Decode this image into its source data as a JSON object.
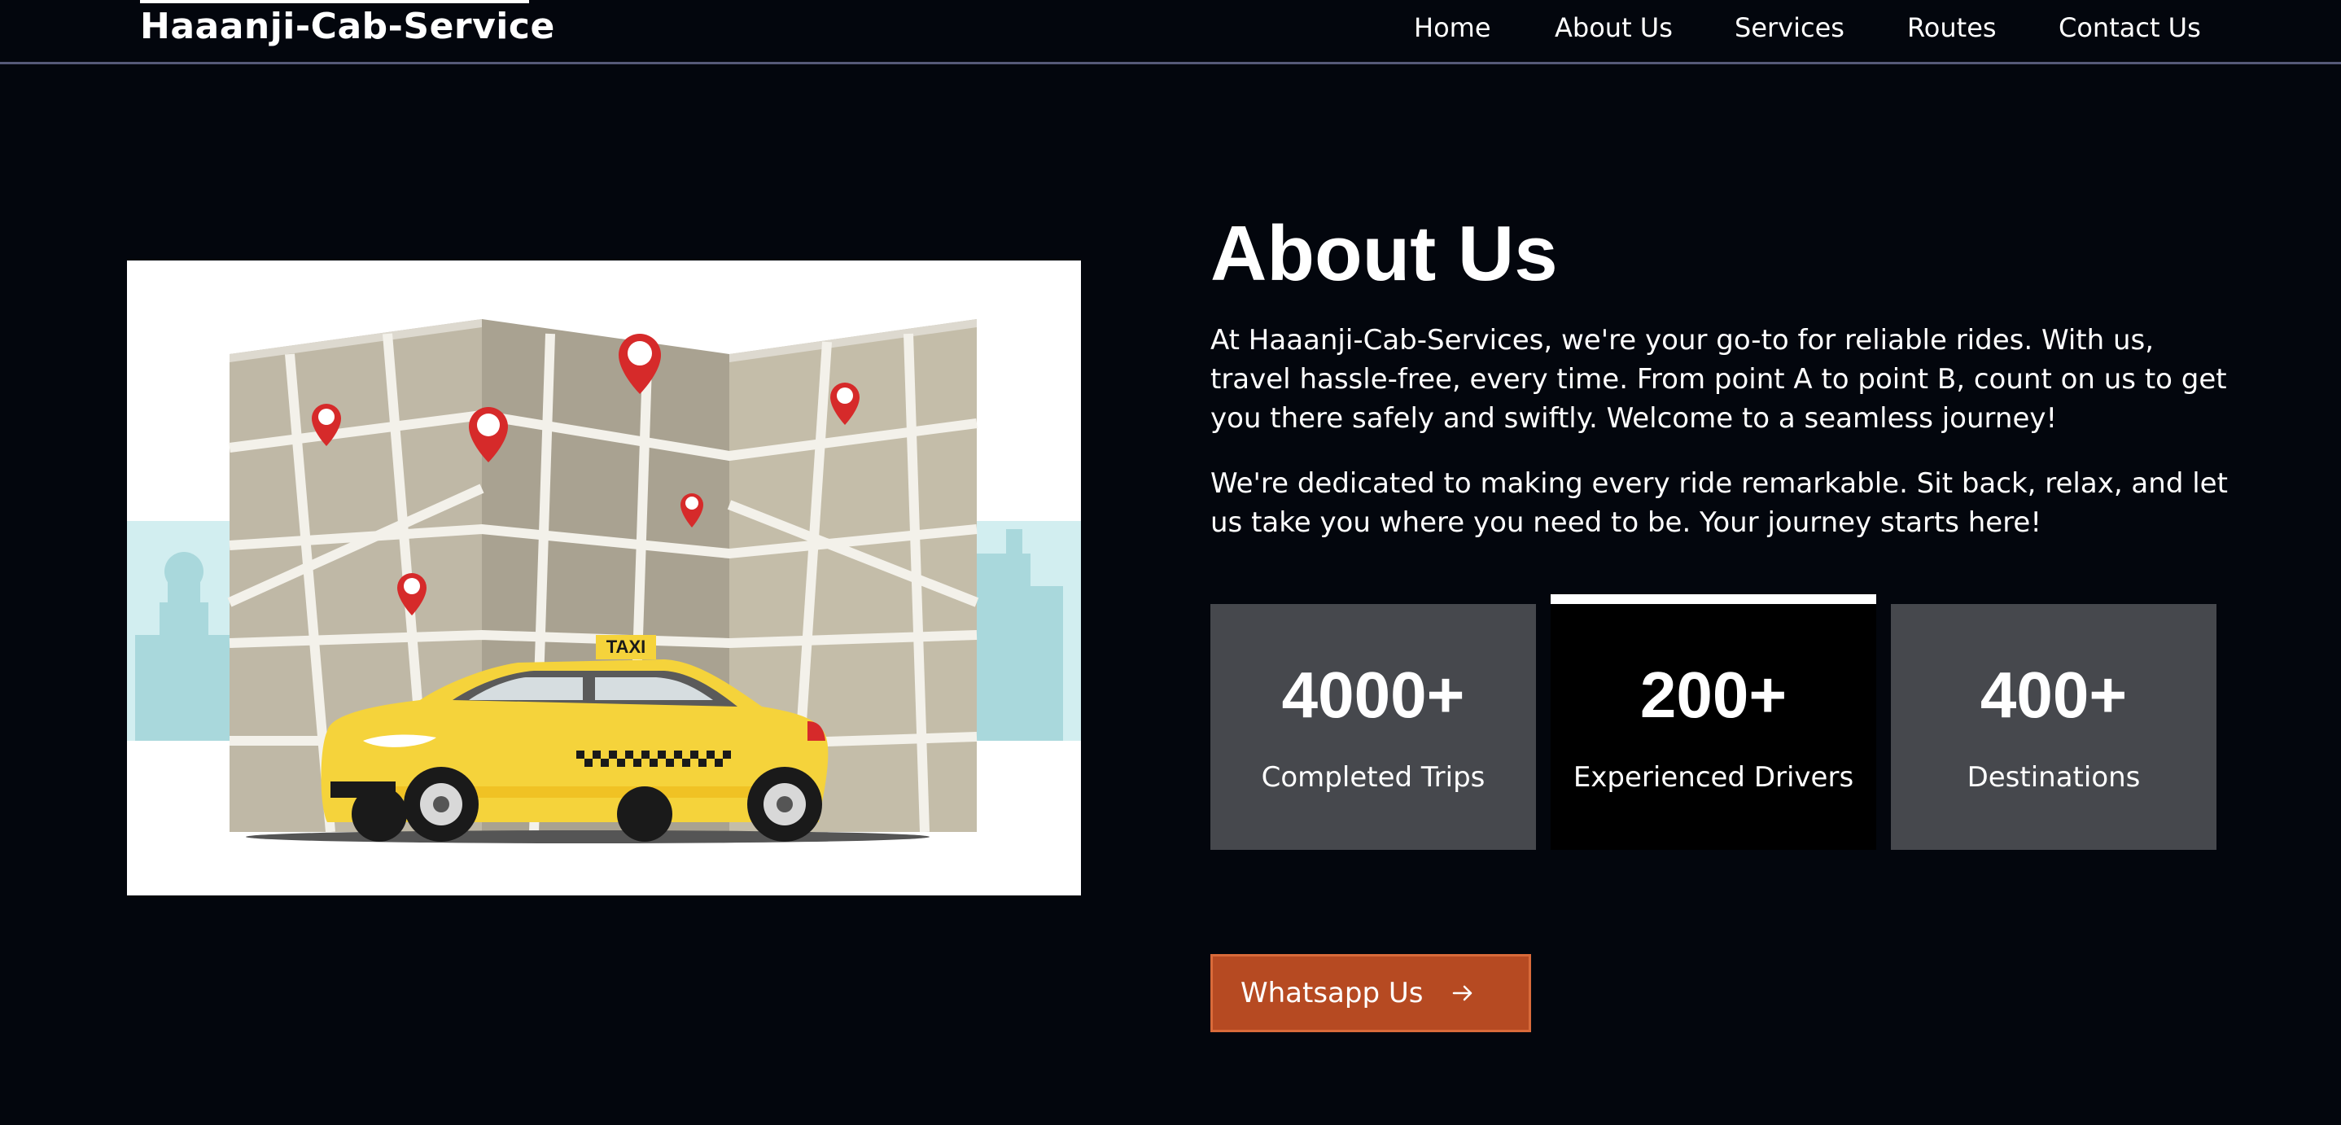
{
  "header": {
    "brand": "Haaanji-Cab-Service",
    "nav": [
      {
        "label": "Home"
      },
      {
        "label": "About Us"
      },
      {
        "label": "Services"
      },
      {
        "label": "Routes"
      },
      {
        "label": "Contact Us"
      }
    ]
  },
  "illustration": {
    "taxi_sign": "TAXI"
  },
  "about": {
    "title": "About Us",
    "paragraph1": "At Haaanji-Cab-Services, we're your go-to for reliable rides. With us, travel hassle-free, every time. From point A to point B, count on us to get you there safely and swiftly. Welcome to a seamless journey!",
    "paragraph2": "We're dedicated to making every ride remarkable. Sit back, relax, and let us take you where you need to be. Your journey starts here!",
    "stats": [
      {
        "value": "4000+",
        "label": "Completed Trips"
      },
      {
        "value": "200+",
        "label": "Experienced Drivers"
      },
      {
        "value": "400+",
        "label": "Destinations"
      }
    ],
    "cta": {
      "label": "Whatsapp Us",
      "icon": "arrow-right-icon",
      "color": "#b64a22"
    }
  }
}
